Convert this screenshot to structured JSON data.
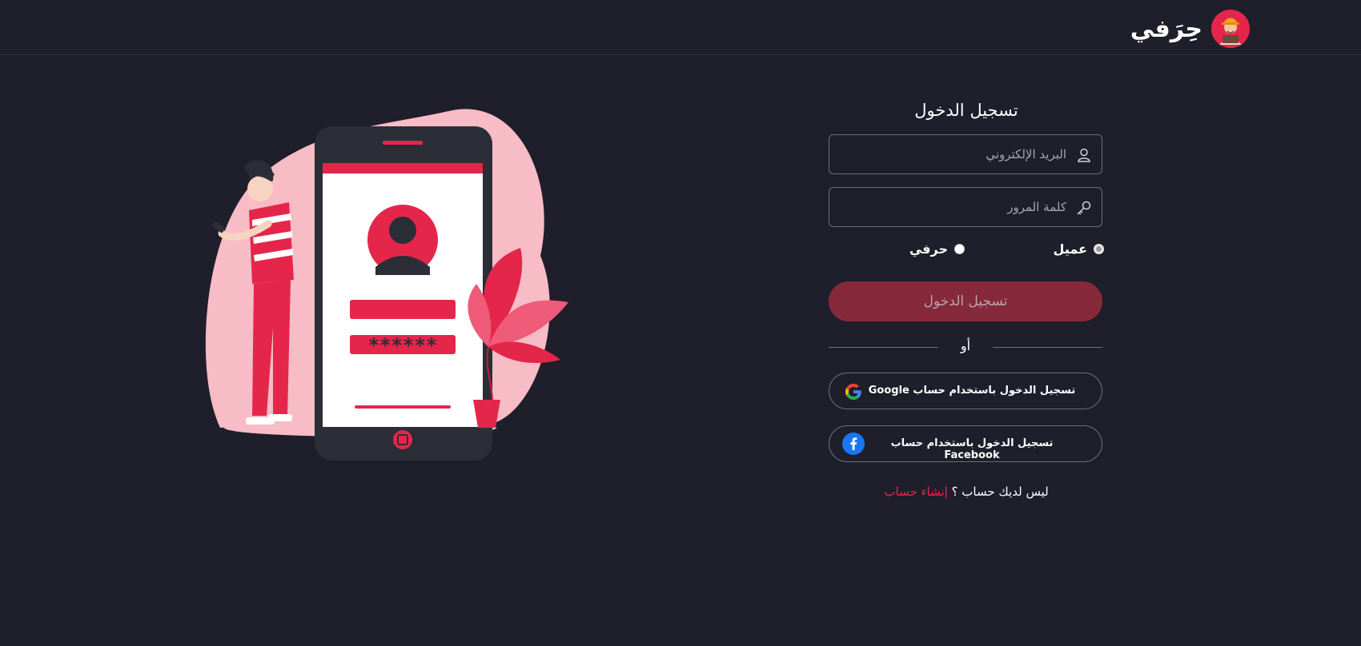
{
  "brand": {
    "name": "حِرَفي"
  },
  "colors": {
    "background": "#1f1f2b",
    "accent": "#e5264b",
    "button": "#86293b",
    "border": "#6d6d78"
  },
  "login": {
    "title": "تسجيل الدخول",
    "email_placeholder": "البريد الإلكتروني",
    "password_placeholder": "كلمة المرور",
    "role_client": "عميل",
    "role_craftsman": "حرفي",
    "submit_label": "تسجيل الدخول",
    "or_label": "أو",
    "google_label": "تسجيل الدخول باستخدام حساب Google",
    "facebook_label": "تسجيل الدخول باستخدام حساب Facebook",
    "no_account_text": "ليس لديك حساب ؟",
    "create_account_label": "إنشاء حساب"
  },
  "illustration": {
    "password_mask": "******"
  }
}
